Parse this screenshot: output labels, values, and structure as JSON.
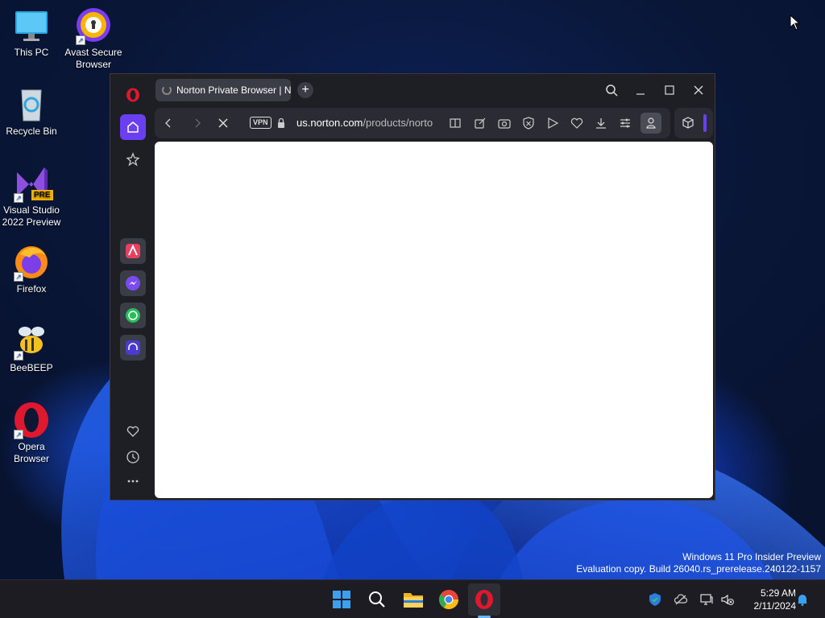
{
  "desktop": {
    "icons": [
      {
        "label": "This PC"
      },
      {
        "label": "Avast Secure Browser"
      },
      {
        "label": "Recycle Bin"
      },
      {
        "label": "Visual Studio 2022 Preview"
      },
      {
        "label": "Firefox"
      },
      {
        "label": "BeeBEEP"
      },
      {
        "label": "Opera Browser"
      }
    ],
    "vs_badge": "PRE"
  },
  "browser": {
    "tab_title": "Norton Private Browser | N",
    "new_tab_label": "+",
    "vpn_label": "VPN",
    "url_domain": "us.norton.com",
    "url_path": "/products/norto"
  },
  "watermark": {
    "line1": "Windows 11 Pro Insider Preview",
    "line2": "Evaluation copy. Build 26040.rs_prerelease.240122-1157"
  },
  "taskbar": {
    "time": "5:29 AM",
    "date": "2/11/2024"
  },
  "colors": {
    "accent": "#6a3ff0",
    "opera_red": "#e0182d"
  }
}
